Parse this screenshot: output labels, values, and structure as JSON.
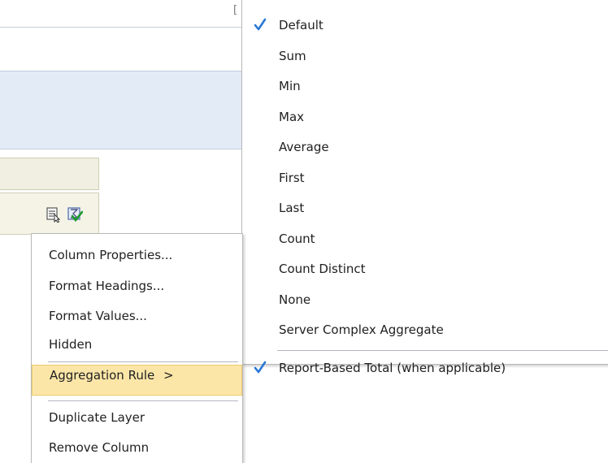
{
  "submenu": {
    "items": [
      {
        "label": "Default",
        "checked": true
      },
      {
        "label": "Sum",
        "checked": false
      },
      {
        "label": "Min",
        "checked": false
      },
      {
        "label": "Max",
        "checked": false
      },
      {
        "label": "Average",
        "checked": false
      },
      {
        "label": "First",
        "checked": false
      },
      {
        "label": "Last",
        "checked": false
      },
      {
        "label": "Count",
        "checked": false
      },
      {
        "label": "Count Distinct",
        "checked": false
      },
      {
        "label": "None",
        "checked": false
      },
      {
        "label": "Server Complex Aggregate",
        "checked": false
      }
    ],
    "report_total": {
      "label": "Report-Based Total (when applicable)",
      "checked": true
    }
  },
  "context_menu": {
    "items": [
      {
        "label": "Column Properties..."
      },
      {
        "label": "Format Headings..."
      },
      {
        "label": "Format Values..."
      },
      {
        "label": "Hidden"
      }
    ],
    "aggregation": {
      "label": "Aggregation Rule",
      "arrow": ">",
      "highlighted": true
    },
    "bottom_items": [
      {
        "label": "Duplicate Layer"
      },
      {
        "label": "Remove Column"
      }
    ]
  },
  "icons": [
    "properties-icon",
    "checklist-icon",
    "checkmark-icon"
  ],
  "colors": {
    "check": "#2a78d6",
    "highlight": "#fbe6a8",
    "blue_band": "#e3ebf7",
    "beige": "#f0efe1"
  }
}
